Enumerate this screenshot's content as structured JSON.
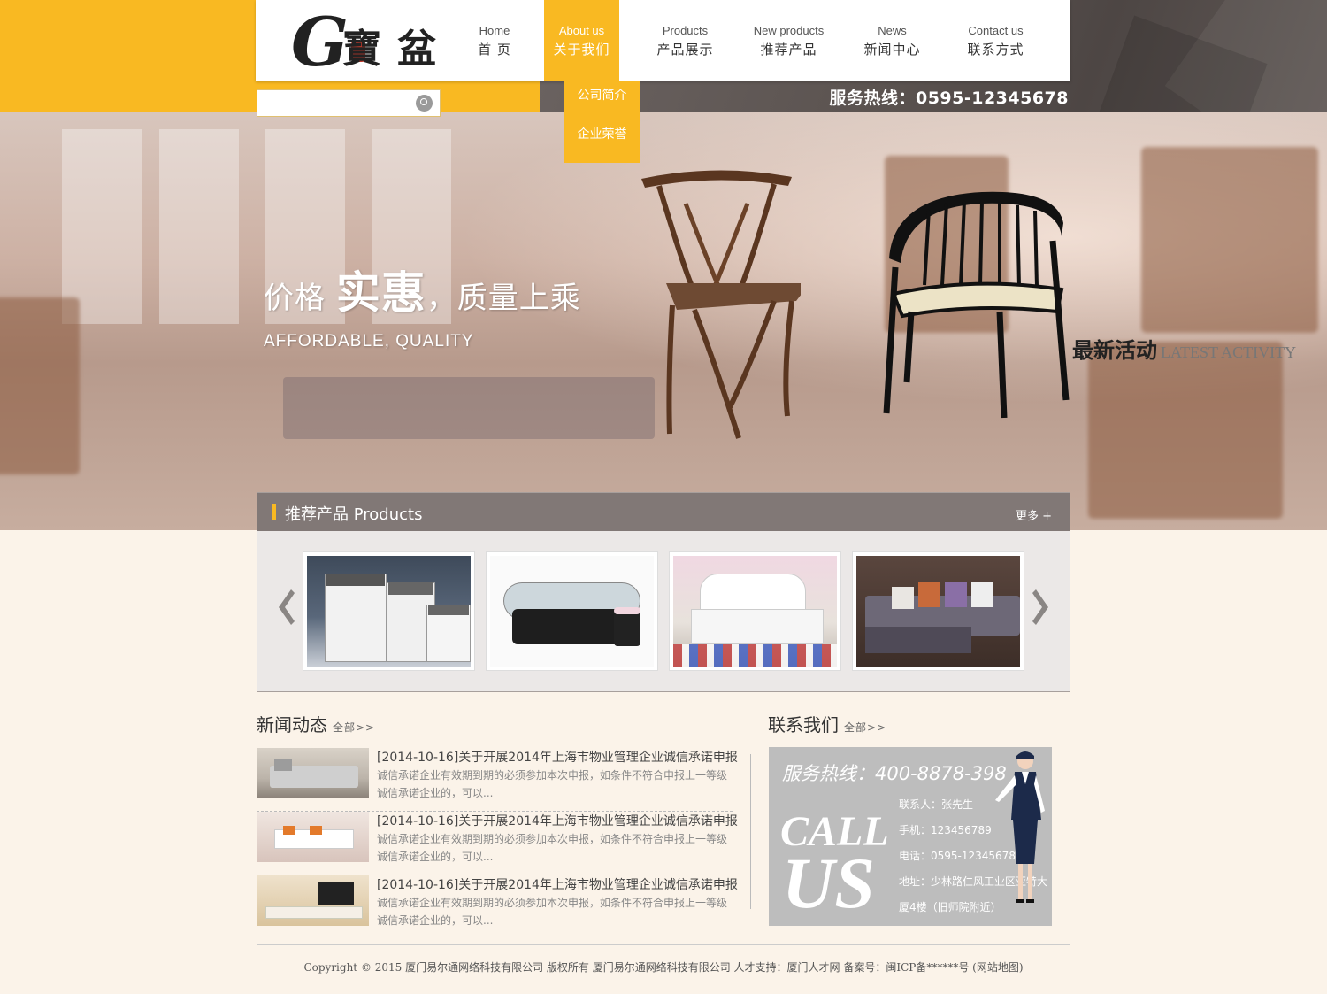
{
  "brand": {
    "logo_text": "G寶盆",
    "logo_letter": "G"
  },
  "nav": [
    {
      "en": "Home",
      "zh": "首 页",
      "active": false
    },
    {
      "en": "About us",
      "zh": "关于我们",
      "active": true
    },
    {
      "en": "Products",
      "zh": "产品展示",
      "active": false
    },
    {
      "en": "New products",
      "zh": "推荐产品",
      "active": false
    },
    {
      "en": "News",
      "zh": "新闻中心",
      "active": false
    },
    {
      "en": "Contact us",
      "zh": "联系方式",
      "active": false
    }
  ],
  "dropdown": [
    "公司简介",
    "企业荣誉"
  ],
  "search": {
    "placeholder": ""
  },
  "hotline": "服务热线：0595-12345678",
  "banner": {
    "slogan_prefix": "价格",
    "slogan_big": "实惠",
    "slogan_suffix": "，质量上乘",
    "slogan_en": "AFFORDABLE, QUALITY",
    "latest_zh": "最新活动",
    "latest_en": "LATEST ACTIVITY"
  },
  "products": {
    "title": "推荐产品 Products",
    "more": "更多 +",
    "items": [
      {
        "name": "cabinet"
      },
      {
        "name": "glass-table"
      },
      {
        "name": "bed"
      },
      {
        "name": "sofa"
      }
    ]
  },
  "news": {
    "title": "新闻动态",
    "more": "全部>>",
    "items": [
      {
        "headline": "[2014-10-16]关于开展2014年上海市物业管理企业诚信承诺申报",
        "summary": "诚信承诺企业有效期到期的必须参加本次申报，如条件不符合申报上一等级诚信承诺企业的，可以..."
      },
      {
        "headline": "[2014-10-16]关于开展2014年上海市物业管理企业诚信承诺申报",
        "summary": "诚信承诺企业有效期到期的必须参加本次申报，如条件不符合申报上一等级诚信承诺企业的，可以..."
      },
      {
        "headline": "[2014-10-16]关于开展2014年上海市物业管理企业诚信承诺申报",
        "summary": "诚信承诺企业有效期到期的必须参加本次申报，如条件不符合申报上一等级诚信承诺企业的，可以..."
      }
    ]
  },
  "contact": {
    "title": "联系我们",
    "more": "全部>>",
    "hotline": "服务热线：400-8878-398",
    "call": "CALL",
    "us": "US",
    "person": "联系人：张先生",
    "mobile": "手机：123456789",
    "phone": "电话：0595-12345678",
    "address": "地址：少林路仁风工业区亚特大厦4楼（旧师院附近）"
  },
  "footer": "Copyright © 2015 厦门易尔通网络科技有限公司 版权所有 厦门易尔通网络科技有限公司 人才支持：厦门人才网 备案号：闽ICP备******号 (网站地图)",
  "colors": {
    "accent": "#f9b922",
    "dark": "#5b5350",
    "bg": "#fbf3e9"
  }
}
